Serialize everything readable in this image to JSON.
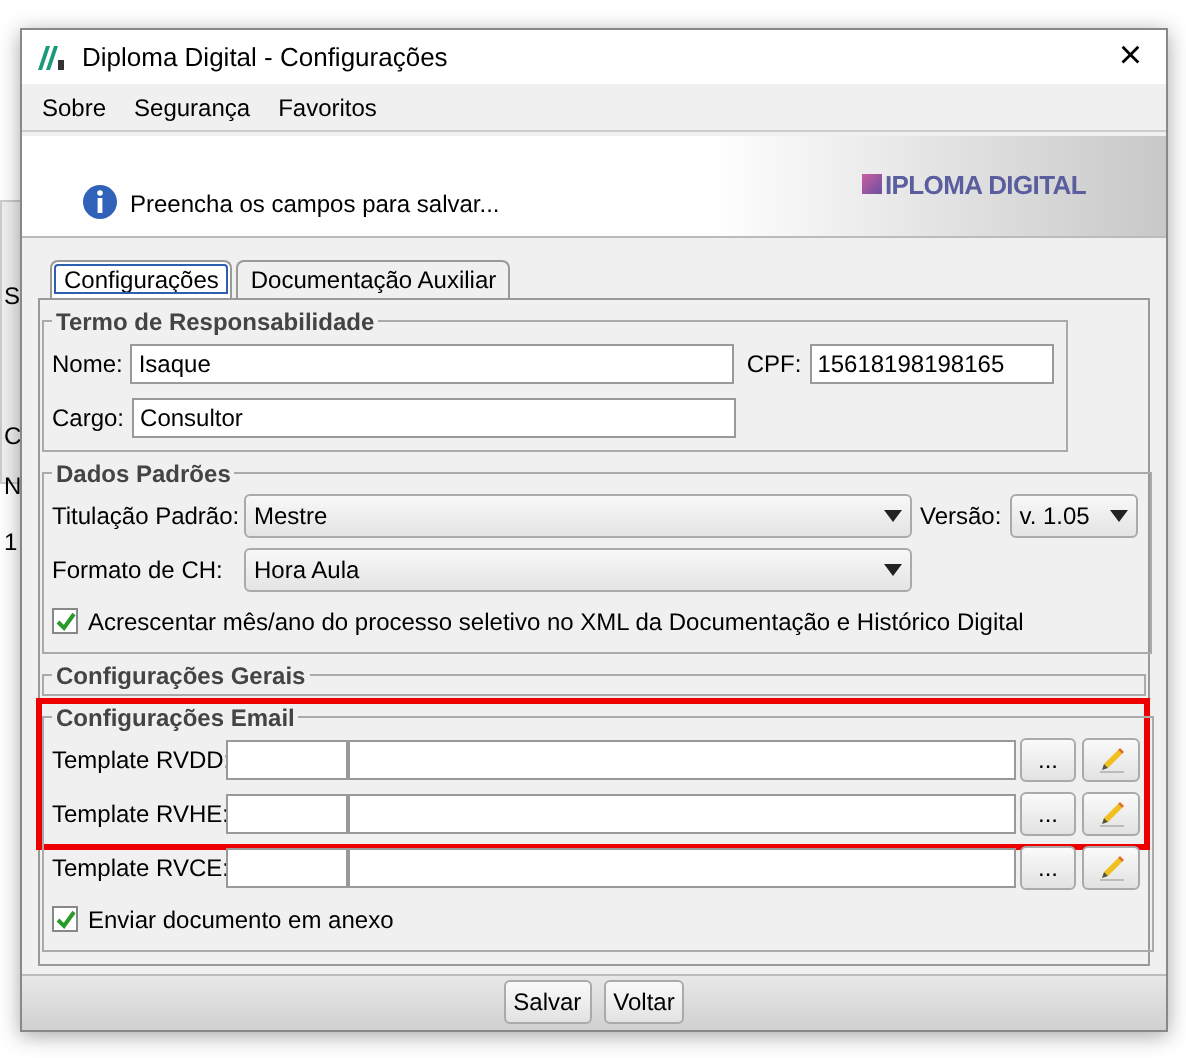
{
  "background_window": {
    "texts": [
      "S",
      "C",
      "N",
      "1"
    ]
  },
  "window": {
    "title": "Diploma Digital - Configurações",
    "close": "×"
  },
  "menu": [
    "Sobre",
    "Segurança",
    "Favoritos"
  ],
  "header": {
    "message": "Preencha os campos para salvar...",
    "logo": "IPLOMA DIGITAL"
  },
  "tabs": [
    {
      "label": "Configurações",
      "selected": true
    },
    {
      "label": "Documentação Auxiliar",
      "selected": false
    }
  ],
  "termo": {
    "title": "Termo de Responsabilidade",
    "nome_label": "Nome:",
    "nome": "Isaque",
    "cpf_label": "CPF:",
    "cpf": "15618198198165",
    "cargo_label": "Cargo:",
    "cargo": "Consultor"
  },
  "dados": {
    "title": "Dados Padrões",
    "titulacao_label": "Titulação Padrão:",
    "titulacao": "Mestre",
    "versao_label": "Versão:",
    "versao": "v. 1.05",
    "formato_label": "Formato de CH:",
    "formato": "Hora Aula",
    "acrescentar": {
      "label": "Acrescentar mês/ano do processo seletivo no XML da Documentação e Histórico Digital",
      "checked": true
    }
  },
  "gerais": {
    "title": "Configurações Gerais"
  },
  "email": {
    "title": "Configurações Email",
    "rows": [
      {
        "label": "Template RVDD:",
        "browse": "...",
        "highlighted": true
      },
      {
        "label": "Template RVHE:",
        "browse": "...",
        "highlighted": true
      },
      {
        "label": "Template RVCE:",
        "browse": "...",
        "highlighted": false
      }
    ],
    "anexo": {
      "label": "Enviar documento em anexo",
      "checked": true
    }
  },
  "buttons": [
    "Salvar",
    "Voltar"
  ]
}
